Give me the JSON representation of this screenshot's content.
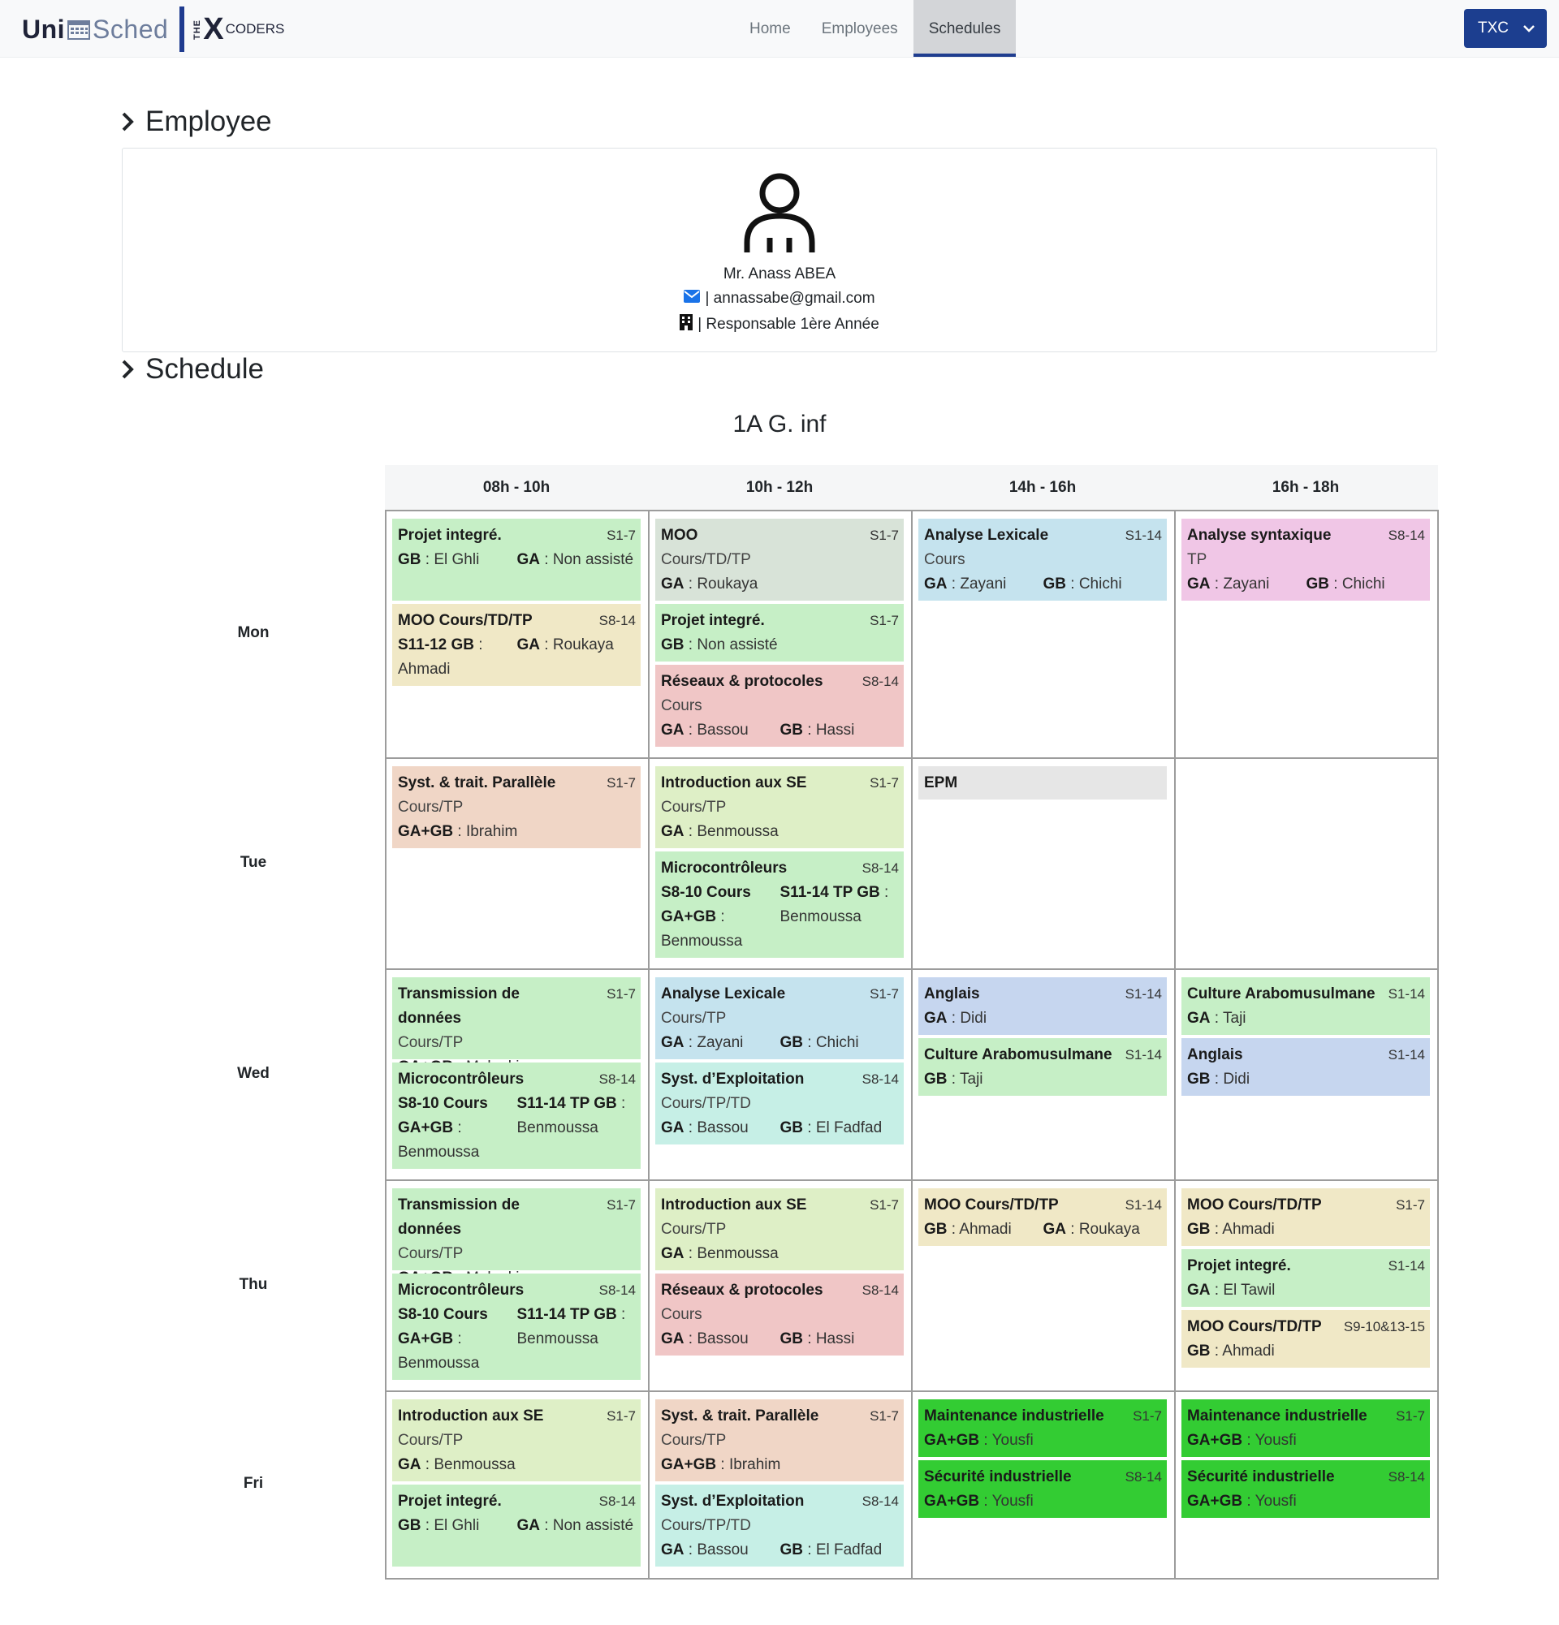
{
  "brand": {
    "uni": "Uni",
    "sched": "Sched",
    "the": "THE",
    "x": "X",
    "coders": "CODERS"
  },
  "nav": {
    "home": "Home",
    "employees": "Employees",
    "schedules": "Schedules",
    "org": "TXC"
  },
  "employee": {
    "heading": "Employee",
    "name": "Mr. Anass ABEA",
    "email": "| annassabe@gmail.com",
    "role": "| Responsable 1ère Année"
  },
  "schedule": {
    "heading": "Schedule",
    "title": "1A G. inf",
    "slots": [
      "08h - 10h",
      "10h - 12h",
      "14h - 16h",
      "16h - 18h"
    ],
    "days": [
      "Mon",
      "Tue",
      "Wed",
      "Thu",
      "Fri"
    ]
  },
  "colors": {
    "green_light": "#c6efc6",
    "grey_green": "#d8e3d8",
    "blue_light": "#c5e3ee",
    "pink": "#f0c6e6",
    "beige": "#f0e8c6",
    "red_light": "#f0c6c6",
    "peach": "#f0d6c6",
    "lime_light": "#deefc6",
    "grey": "#e6e6e6",
    "teal_light": "#c6efe6",
    "blue_periwinkle": "#c6d6ef",
    "green_bright": "#33cc33",
    "nav_active_border": "#1f3d8f",
    "org_button": "#1c3e8f"
  },
  "courses": {
    "mon_0_a": {
      "title": "Projet integré.",
      "wk": "S1-7",
      "g1k": "GB",
      "g1v": ": El Ghli",
      "g2k": "GA",
      "g2v": ": Non assisté"
    },
    "mon_0_b": {
      "title": "MOO Cours/TD/TP",
      "wk": "S8-14",
      "g1k": "S11-12 GB",
      "g1v": ": Ahmadi",
      "g2k": "GA",
      "g2v": ": Roukaya"
    },
    "mon_1_a": {
      "title": "MOO",
      "wk": "S1-7",
      "type": "Cours/TD/TP",
      "g1k": "GA",
      "g1v": ": Roukaya"
    },
    "mon_1_b": {
      "title": "Projet integré.",
      "wk": "S1-7",
      "g1k": "GB",
      "g1v": ": Non assisté"
    },
    "mon_1_c": {
      "title": "Réseaux & protocoles",
      "wk": "S8-14",
      "type": "Cours",
      "g1k": "GA",
      "g1v": ": Bassou",
      "g2k": "GB",
      "g2v": ": Hassi"
    },
    "mon_2_a": {
      "title": "Analyse Lexicale",
      "wk": "S1-14",
      "type": "Cours",
      "g1k": "GA",
      "g1v": ": Zayani",
      "g2k": "GB",
      "g2v": ": Chichi"
    },
    "mon_3_a": {
      "title": "Analyse syntaxique",
      "wk": "S8-14",
      "type": "TP",
      "g1k": "GA",
      "g1v": ": Zayani",
      "g2k": "GB",
      "g2v": ": Chichi"
    },
    "tue_0_a": {
      "title": "Syst. & trait. Parallèle",
      "wk": "S1-7",
      "type": "Cours/TP",
      "g1k": "GA+GB",
      "g1v": ": Ibrahim"
    },
    "tue_1_a": {
      "title": "Introduction aux SE",
      "wk": "S1-7",
      "type": "Cours/TP",
      "g1k": "GA",
      "g1v": ": Benmoussa"
    },
    "tue_1_b": {
      "title": "Microcontrôleurs",
      "wk": "S8-14",
      "g1k": "S8-10 Cours GA+GB",
      "g1v": ": Benmoussa",
      "g2k": "S11-14 TP GB",
      "g2v": ": Benmoussa"
    },
    "tue_2_a": {
      "title": "EPM"
    },
    "wed_0_a": {
      "title": "Transmission de données",
      "wk": "S1-7",
      "type": "Cours/TP",
      "g1k": "GA+GB",
      "g1v": ": Malouki"
    },
    "wed_0_b": {
      "title": "Microcontrôleurs",
      "wk": "S8-14",
      "g1k": "S8-10 Cours GA+GB",
      "g1v": ": Benmoussa",
      "g2k": "S11-14 TP GB",
      "g2v": ": Benmoussa"
    },
    "wed_1_a": {
      "title": "Analyse Lexicale",
      "wk": "S1-7",
      "type": "Cours/TP",
      "g1k": "GA",
      "g1v": ": Zayani",
      "g2k": "GB",
      "g2v": ": Chichi"
    },
    "wed_1_b": {
      "title": "Syst. d’Exploitation",
      "wk": "S8-14",
      "type": "Cours/TP/TD",
      "g1k": "GA",
      "g1v": ": Bassou",
      "g2k": "GB",
      "g2v": ": El Fadfad"
    },
    "wed_2_a": {
      "title": "Anglais",
      "wk": "S1-14",
      "g1k": "GA",
      "g1v": ": Didi"
    },
    "wed_2_b": {
      "title": "Culture Arabomusulmane",
      "wk": "S1-14",
      "g1k": "GB",
      "g1v": ": Taji"
    },
    "wed_3_a": {
      "title": "Culture Arabomusulmane",
      "wk": "S1-14",
      "g1k": "GA",
      "g1v": ": Taji"
    },
    "wed_3_b": {
      "title": "Anglais",
      "wk": "S1-14",
      "g1k": "GB",
      "g1v": ": Didi"
    },
    "thu_0_a": {
      "title": "Transmission de données",
      "wk": "S1-7",
      "type": "Cours/TP",
      "g1k": "GA+GB",
      "g1v": ": Malouki"
    },
    "thu_0_b": {
      "title": "Microcontrôleurs",
      "wk": "S8-14",
      "g1k": "S8-10 Cours GA+GB",
      "g1v": ": Benmoussa",
      "g2k": "S11-14 TP GB",
      "g2v": ": Benmoussa"
    },
    "thu_1_a": {
      "title": "Introduction aux SE",
      "wk": "S1-7",
      "type": "Cours/TP",
      "g1k": "GA",
      "g1v": ": Benmoussa"
    },
    "thu_1_b": {
      "title": "Réseaux & protocoles",
      "wk": "S8-14",
      "type": "Cours",
      "g1k": "GA",
      "g1v": ": Bassou",
      "g2k": "GB",
      "g2v": ": Hassi"
    },
    "thu_2_a": {
      "title": "MOO Cours/TD/TP",
      "wk": "S1-14",
      "g1k": "GB",
      "g1v": ": Ahmadi",
      "g2k": "GA",
      "g2v": ": Roukaya"
    },
    "thu_3_a": {
      "title": "MOO Cours/TD/TP",
      "wk": "S1-7",
      "g1k": "GB",
      "g1v": ": Ahmadi"
    },
    "thu_3_b": {
      "title": "Projet integré.",
      "wk": "S1-14",
      "g1k": "GA",
      "g1v": ": El Tawil"
    },
    "thu_3_c": {
      "title": "MOO Cours/TD/TP",
      "wk": "S9-10&13-15",
      "g1k": "GB",
      "g1v": ": Ahmadi"
    },
    "fri_0_a": {
      "title": "Introduction aux SE",
      "wk": "S1-7",
      "type": "Cours/TP",
      "g1k": "GA",
      "g1v": ": Benmoussa"
    },
    "fri_0_b": {
      "title": "Projet integré.",
      "wk": "S8-14",
      "g1k": "GB",
      "g1v": ": El Ghli",
      "g2k": "GA",
      "g2v": ": Non assisté"
    },
    "fri_1_a": {
      "title": "Syst. & trait. Parallèle",
      "wk": "S1-7",
      "type": "Cours/TP",
      "g1k": "GA+GB",
      "g1v": ": Ibrahim"
    },
    "fri_1_b": {
      "title": "Syst. d’Exploitation",
      "wk": "S8-14",
      "type": "Cours/TP/TD",
      "g1k": "GA",
      "g1v": ": Bassou",
      "g2k": "GB",
      "g2v": ": El Fadfad"
    },
    "fri_2_a": {
      "title": "Maintenance industrielle",
      "wk": "S1-7",
      "g1k": "GA+GB",
      "g1v": ": Yousfi"
    },
    "fri_2_b": {
      "title": "Sécurité industrielle",
      "wk": "S8-14",
      "g1k": "GA+GB",
      "g1v": ": Yousfi"
    },
    "fri_3_a": {
      "title": "Maintenance industrielle",
      "wk": "S1-7",
      "g1k": "GA+GB",
      "g1v": ": Yousfi"
    },
    "fri_3_b": {
      "title": "Sécurité industrielle",
      "wk": "S8-14",
      "g1k": "GA+GB",
      "g1v": ": Yousfi"
    }
  }
}
